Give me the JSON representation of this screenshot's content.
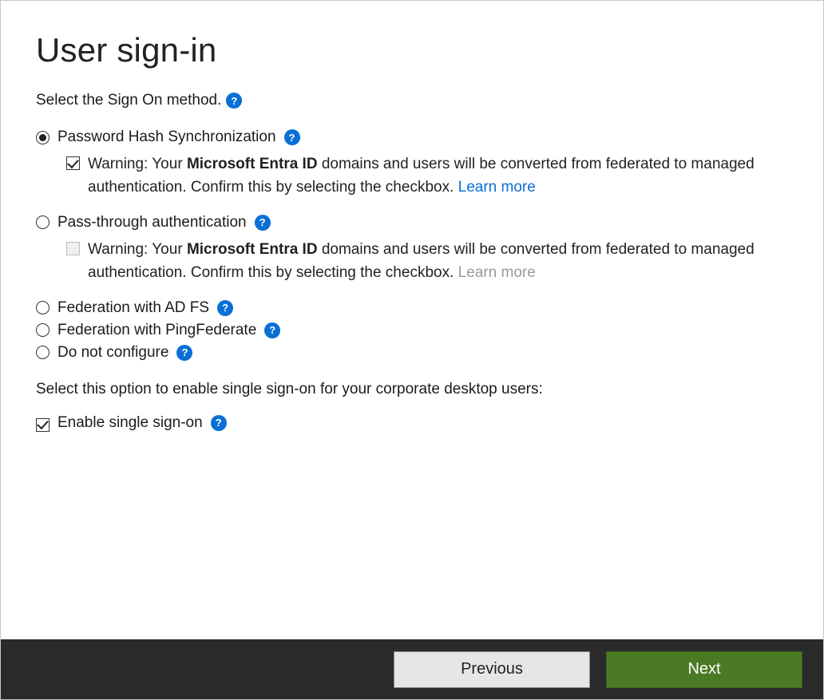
{
  "title": "User sign-in",
  "prompt": "Select the Sign On method.",
  "options": {
    "phs": {
      "label": "Password Hash Synchronization",
      "warning_prefix": "Warning: Your ",
      "warning_bold": "Microsoft Entra ID",
      "warning_rest": " domains and users will be converted from federated to managed authentication. Confirm this by selecting the checkbox. ",
      "learn_more": "Learn more"
    },
    "pta": {
      "label": "Pass-through authentication",
      "warning_prefix": "Warning: Your ",
      "warning_bold": "Microsoft Entra ID",
      "warning_rest": " domains and users will be converted from federated to managed authentication. Confirm this by selecting the checkbox. ",
      "learn_more": "Learn more"
    },
    "adfs": {
      "label": "Federation with AD FS"
    },
    "ping": {
      "label": "Federation with PingFederate"
    },
    "none": {
      "label": "Do not configure"
    }
  },
  "sso_prompt": "Select this option to enable single sign-on for your corporate desktop users:",
  "sso_label": "Enable single sign-on",
  "buttons": {
    "previous": "Previous",
    "next": "Next"
  }
}
